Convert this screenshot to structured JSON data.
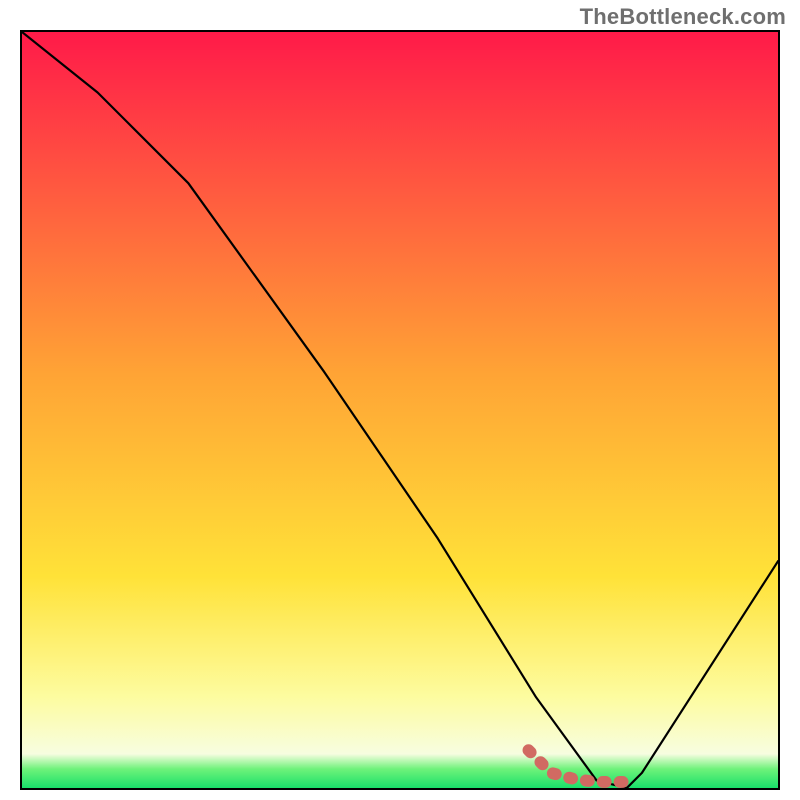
{
  "watermark": {
    "text": "TheBottleneck.com"
  },
  "chart_data": {
    "type": "line",
    "title": "",
    "xlabel": "",
    "ylabel": "",
    "xlim": [
      0,
      100
    ],
    "ylim": [
      0,
      100
    ],
    "grid": false,
    "legend": false,
    "series": [
      {
        "name": "bottleneck-curve",
        "x": [
          0,
          10,
          22,
          40,
          55,
          68,
          76,
          80,
          82,
          100
        ],
        "y": [
          100,
          92,
          80,
          55,
          33,
          12,
          1,
          0,
          2,
          30
        ]
      },
      {
        "name": "optimal-range-marker",
        "x": [
          67,
          70,
          73,
          76,
          78,
          80
        ],
        "y": [
          5,
          2,
          1.2,
          0.8,
          0.8,
          0.8
        ]
      }
    ],
    "gradient_stops": [
      {
        "pos": 0.0,
        "color": "#ff1a49"
      },
      {
        "pos": 0.45,
        "color": "#ffa335"
      },
      {
        "pos": 0.72,
        "color": "#ffe238"
      },
      {
        "pos": 0.88,
        "color": "#fdfca0"
      },
      {
        "pos": 0.955,
        "color": "#f7fde0"
      },
      {
        "pos": 0.975,
        "color": "#6ef27a"
      },
      {
        "pos": 1.0,
        "color": "#19e06a"
      }
    ]
  }
}
